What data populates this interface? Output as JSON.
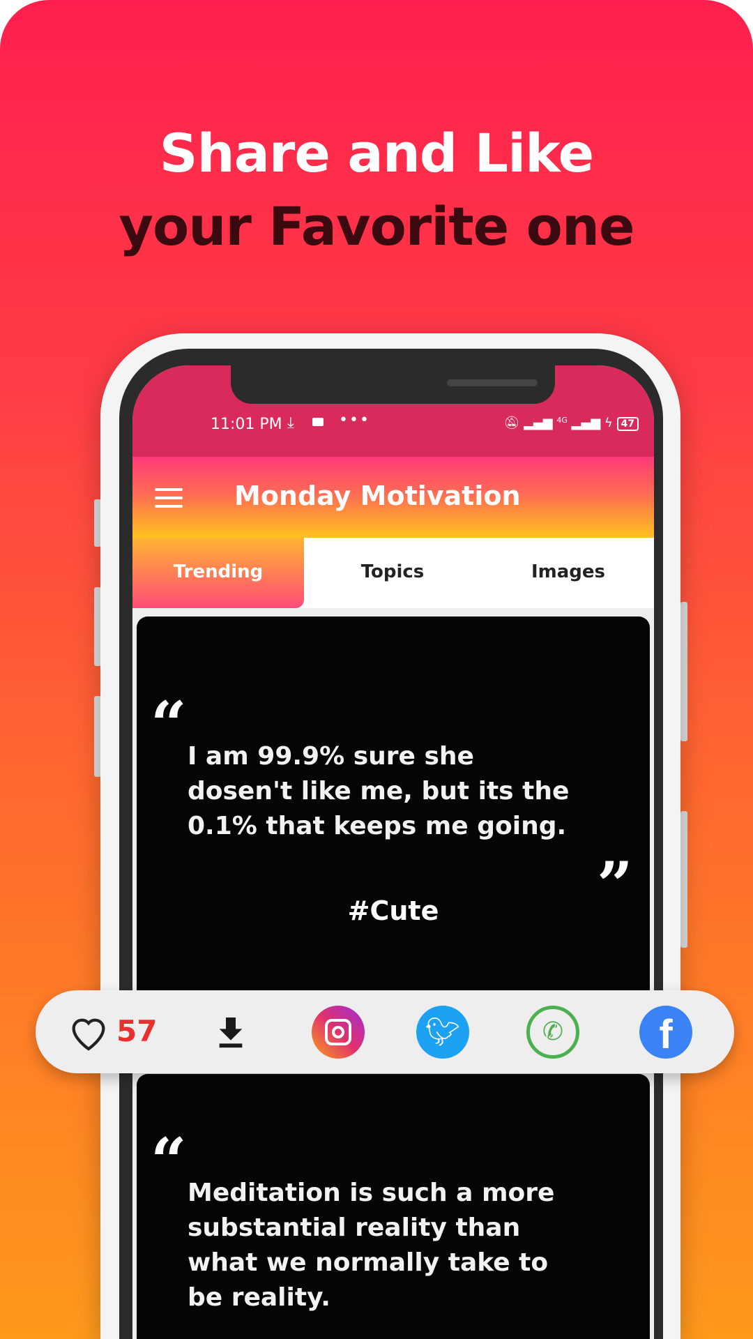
{
  "headline": {
    "line1": "Share and Like",
    "line2": "your Favorite one"
  },
  "status_bar": {
    "time": "11:01 PM",
    "network": "4G",
    "battery": "47"
  },
  "app": {
    "title": "Monday Motivation"
  },
  "tabs": [
    {
      "label": "Trending",
      "active": true
    },
    {
      "label": "Topics"
    },
    {
      "label": "Images"
    }
  ],
  "cards": [
    {
      "open_quote": "“",
      "close_quote": "”",
      "lines": [
        "I am 99.9% sure she",
        "dosen't like me, but its the",
        "0.1% that keeps me going."
      ],
      "tag": "#Cute"
    },
    {
      "open_quote": "“",
      "lines": [
        "Meditation is such a more",
        "substantial reality than",
        "what we normally take to",
        "be reality."
      ]
    }
  ],
  "share_bar": {
    "likes": "57",
    "icons": [
      "heart-icon",
      "download-icon",
      "instagram-icon",
      "twitter-icon",
      "whatsapp-icon",
      "facebook-icon"
    ],
    "colors": {
      "likes": "#e8302e",
      "twitter": "#1da1f2",
      "whatsapp": "#4caf50",
      "facebook": "#3b82f6"
    }
  }
}
